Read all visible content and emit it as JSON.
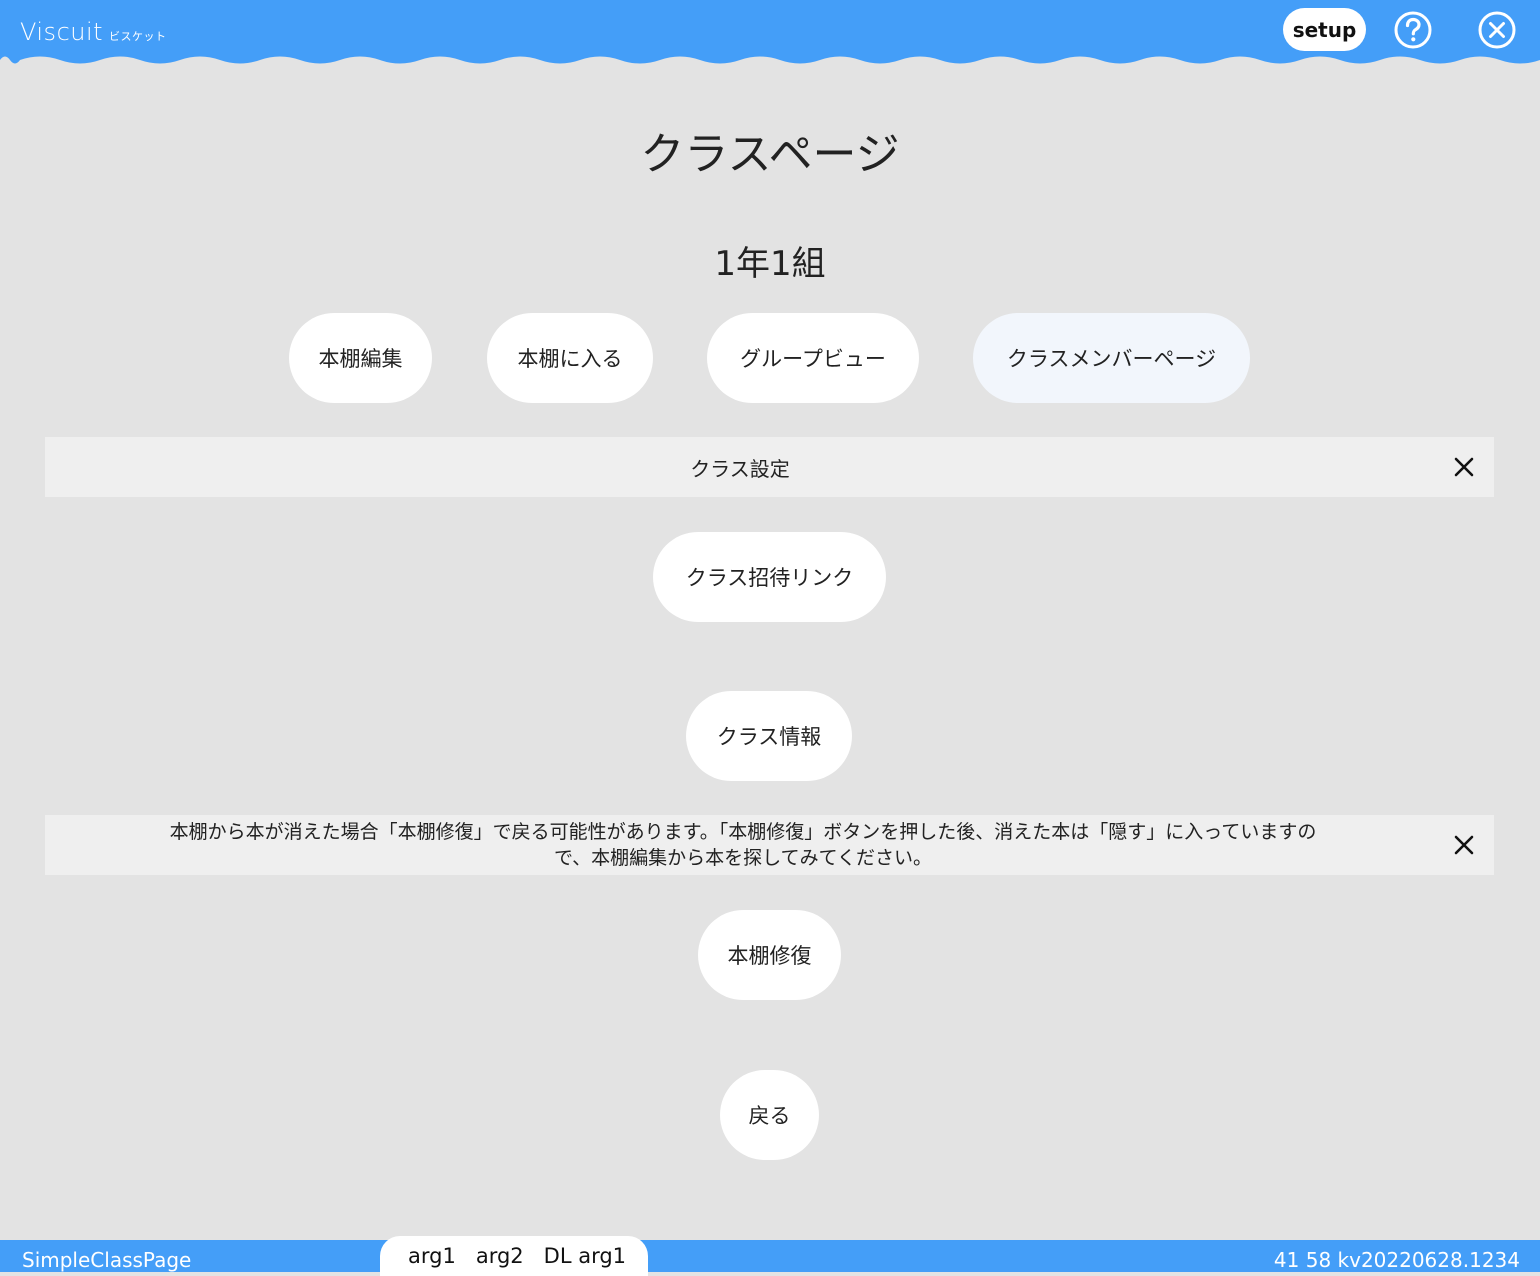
{
  "header": {
    "logo_main": "Viscuit",
    "logo_sub": "ビスケット",
    "setup_label": "setup",
    "icons": [
      "help-icon",
      "close-icon"
    ],
    "bg_color": "#449ef8"
  },
  "page": {
    "title": "クラスページ",
    "class_name": "1年1組"
  },
  "nav_buttons": [
    {
      "label": "本棚編集"
    },
    {
      "label": "本棚に入る"
    },
    {
      "label": "グループビュー"
    },
    {
      "label": "クラスメンバーページ"
    }
  ],
  "settings_bar": {
    "label": "クラス設定",
    "close_icon": "close-x-icon"
  },
  "settings_buttons": {
    "invite_link": "クラス招待リンク",
    "class_info": "クラス情報"
  },
  "repair_notice": {
    "line1": "本棚から本が消えた場合「本棚修復」で戻る可能性があります。「本棚修復」ボタンを押した後、消えた本は「隠す」に入っていますの",
    "line2": "で、本棚編集から本を探してみてください。",
    "close_icon": "close-x-icon"
  },
  "repair_button": "本棚修復",
  "back_button": "戻る",
  "footer": {
    "page_name": "SimpleClassPage",
    "tabs": [
      "arg1",
      "arg2",
      "DL arg1"
    ],
    "version": "41 58 kv20220628.1234"
  }
}
